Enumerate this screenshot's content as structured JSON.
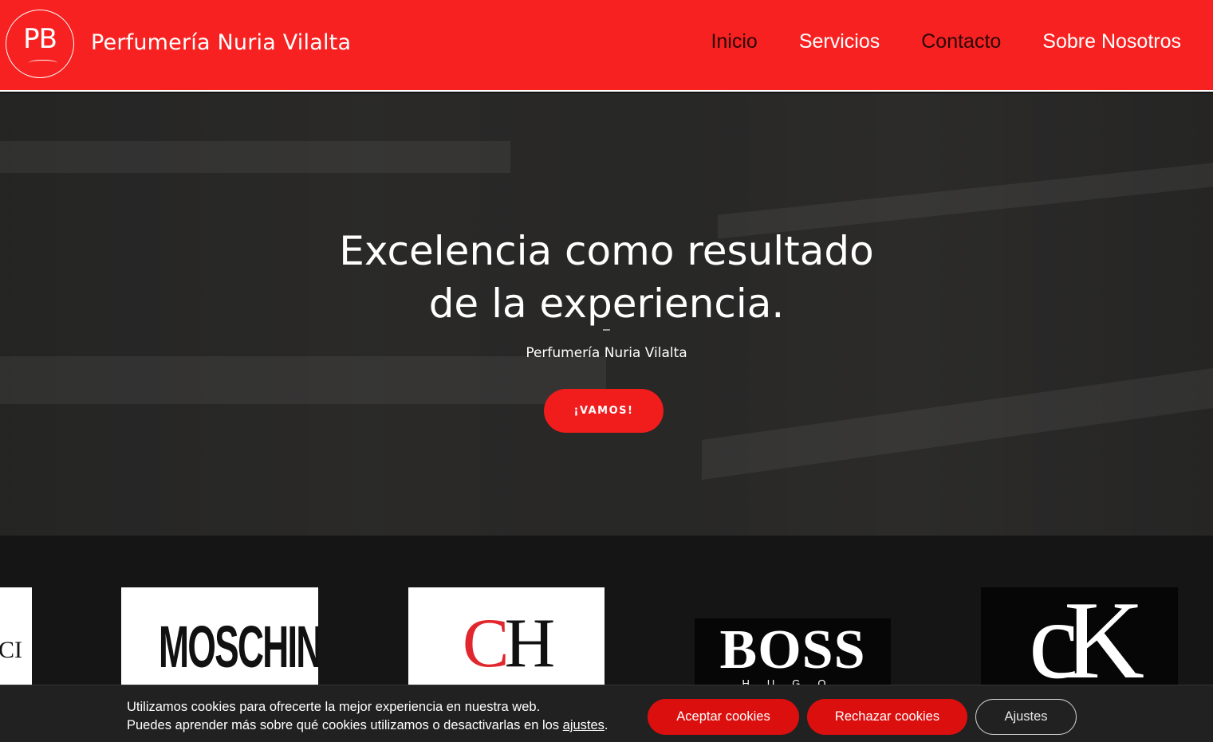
{
  "header": {
    "logo_text": "PB",
    "site_name": "Perfumería Nuria Vilalta",
    "nav": [
      {
        "label": "Inicio"
      },
      {
        "label": "Servicios"
      },
      {
        "label": "Contacto"
      },
      {
        "label": "Sobre Nosotros"
      }
    ],
    "background_color": "#f72121"
  },
  "hero": {
    "title_line1": "Excelencia como resultado",
    "title_line2": "de la experiencia.",
    "dash": "–",
    "subtitle": "Perfumería Nuria Vilalta",
    "button_label": "¡VAMOS!",
    "button_color": "#f11c1c"
  },
  "brands": {
    "items": [
      {
        "name": "gucci-logo",
        "text": "CI"
      },
      {
        "name": "moschino-logo",
        "text": "MOSCHINO"
      },
      {
        "name": "ch-logo",
        "c": "C",
        "h": "H"
      },
      {
        "name": "boss-logo",
        "text": "BOSS",
        "sub": "HUGO BOSS"
      },
      {
        "name": "ck-logo",
        "text": "cK"
      }
    ]
  },
  "cookie_banner": {
    "line1": "Utilizamos cookies para ofrecerte la mejor experiencia en nuestra web.",
    "line2_prefix": "Puedes aprender más sobre qué cookies utilizamos o desactivarlas en los ",
    "line2_link": "ajustes",
    "line2_suffix": ".",
    "accept_label": "Aceptar cookies",
    "reject_label": "Rechazar cookies",
    "settings_label": "Ajustes",
    "button_color": "#dc0f0f"
  }
}
